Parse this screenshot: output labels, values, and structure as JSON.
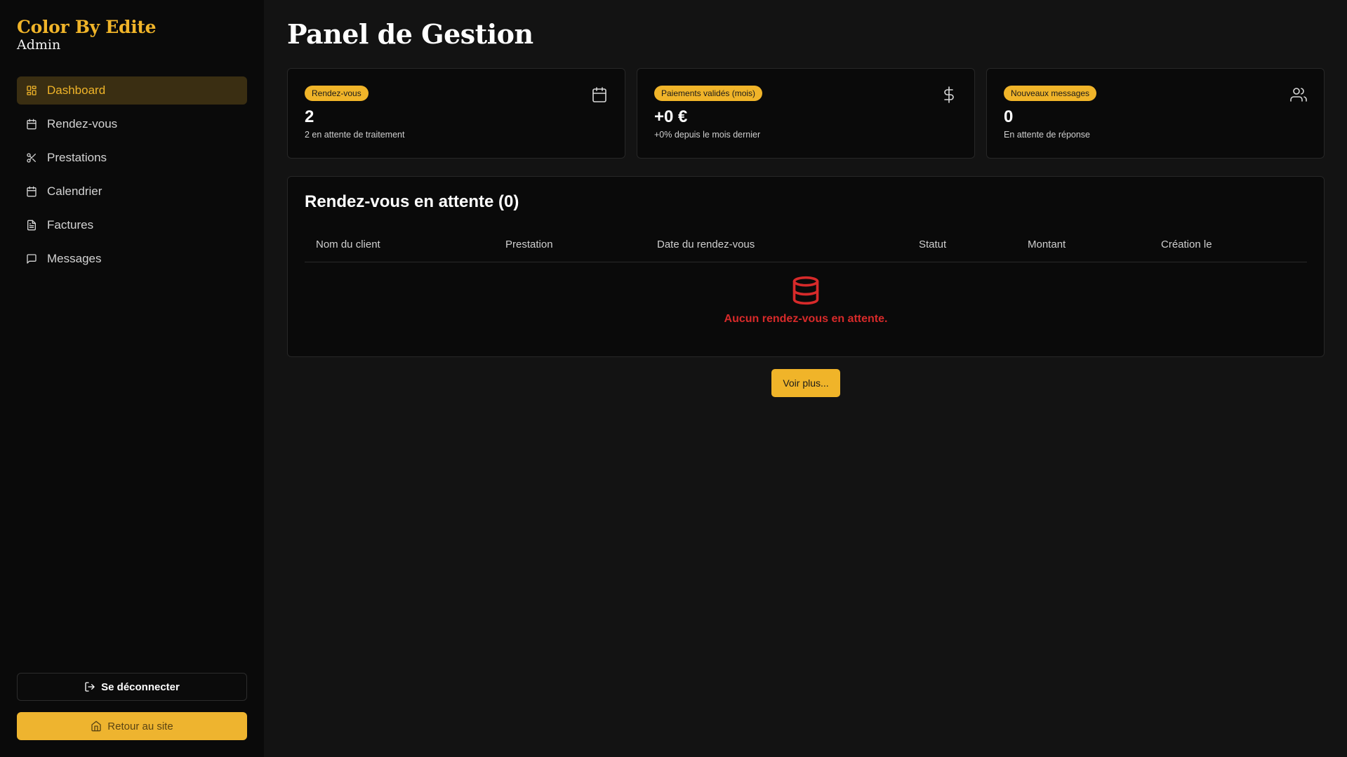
{
  "sidebar": {
    "brand": "Color By Edite",
    "subtitle": "Admin",
    "items": [
      {
        "label": "Dashboard",
        "icon": "layout-grid-icon",
        "active": true
      },
      {
        "label": "Rendez-vous",
        "icon": "calendar-icon"
      },
      {
        "label": "Prestations",
        "icon": "scissors-icon"
      },
      {
        "label": "Calendrier",
        "icon": "calendar-icon"
      },
      {
        "label": "Factures",
        "icon": "file-text-icon"
      },
      {
        "label": "Messages",
        "icon": "message-square-icon"
      }
    ],
    "logout_label": "Se déconnecter",
    "home_label": "Retour au site"
  },
  "main": {
    "title": "Panel de Gestion",
    "cards": [
      {
        "badge": "Rendez-vous",
        "value": "2",
        "sub": "2 en attente de traitement",
        "icon": "calendar-icon"
      },
      {
        "badge": "Paiements validés (mois)",
        "value": "+0 €",
        "sub": "+0% depuis le mois dernier",
        "icon": "dollar-icon"
      },
      {
        "badge": "Nouveaux messages",
        "value": "0",
        "sub": "En attente de réponse",
        "icon": "users-icon"
      }
    ],
    "panel": {
      "title": "Rendez-vous en attente (0)",
      "columns": [
        "Nom du client",
        "Prestation",
        "Date du rendez-vous",
        "Statut",
        "Montant",
        "Création le"
      ],
      "empty_text": "Aucun rendez-vous en attente.",
      "empty_icon": "database-icon"
    },
    "more_label": "Voir plus..."
  },
  "colors": {
    "accent": "#f0b429",
    "error": "#d72a2a",
    "background": "#131313",
    "sidebar": "#0a0a0a"
  }
}
